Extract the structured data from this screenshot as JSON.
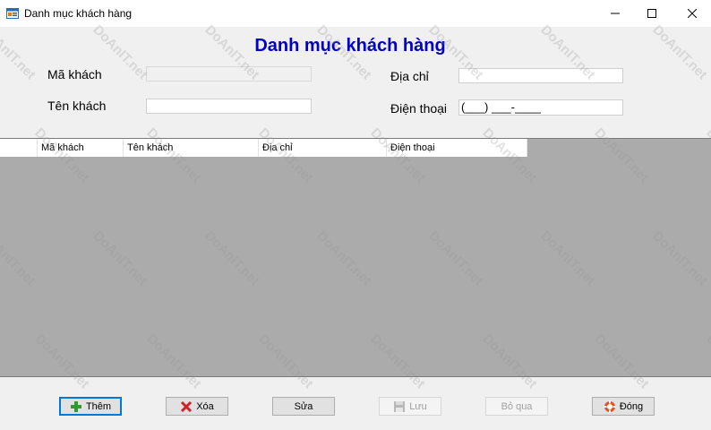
{
  "window": {
    "title": "Danh mục khách hàng",
    "minimize_glyph": "—",
    "maximize_glyph": "☐",
    "close_glyph": "✕"
  },
  "form": {
    "heading": "Danh mục khách hàng",
    "fields": {
      "ma_khach_label": "Mã khách",
      "ma_khach_value": "",
      "ten_khach_label": "Tên khách",
      "ten_khach_value": "",
      "dia_chi_label": "Địa chỉ",
      "dia_chi_value": "",
      "dien_thoai_label": "Điện thoại",
      "dien_thoai_value": "(___) ___-____"
    }
  },
  "grid": {
    "columns": [
      "Mã khách",
      "Tên khách",
      "Địa chỉ",
      "Điện thoại"
    ],
    "rows": []
  },
  "buttons": {
    "them": "Thêm",
    "xoa": "Xóa",
    "sua": "Sửa",
    "luu": "Lưu",
    "bo_qua": "Bỏ qua",
    "dong": "Đóng"
  },
  "watermark": "DoAnIT.net",
  "icons": {
    "app": "form-app-icon",
    "them": "plus-icon",
    "xoa": "x-icon",
    "luu": "save-disk-icon",
    "dong": "lifebuoy-icon"
  },
  "colors": {
    "heading": "#0000c8",
    "grid_background": "#ababab",
    "focus_border": "#0078d7"
  }
}
